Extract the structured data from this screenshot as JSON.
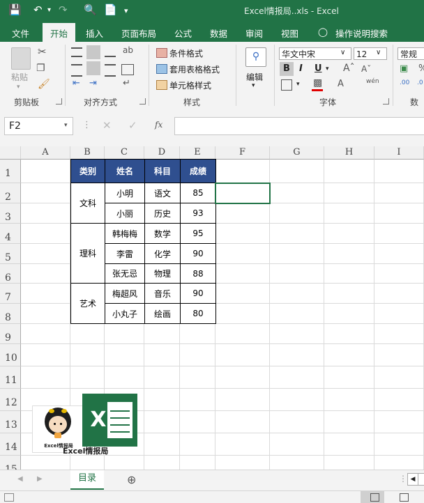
{
  "window": {
    "title": "Excel情报局..xls  -  Excel"
  },
  "ribbon": {
    "tabs": [
      "文件",
      "开始",
      "插入",
      "页面布局",
      "公式",
      "数据",
      "审阅",
      "视图",
      "操作说明搜索"
    ],
    "active_tab": "开始",
    "groups": {
      "clipboard": {
        "label": "剪贴板",
        "paste": "粘贴"
      },
      "alignment": {
        "label": "对齐方式"
      },
      "styles": {
        "label": "样式",
        "conditional": "条件格式",
        "table_format": "套用表格格式",
        "cell_styles": "单元格样式"
      },
      "editing": {
        "label": "编辑"
      },
      "font": {
        "label": "字体",
        "name": "华文中宋",
        "size": "12",
        "bold": "B",
        "italic": "I",
        "underline": "U"
      },
      "number": {
        "label": "数字",
        "format": "常规"
      }
    }
  },
  "formula_bar": {
    "name_box": "F2",
    "fx": "fx",
    "value": ""
  },
  "grid": {
    "columns": [
      "A",
      "B",
      "C",
      "D",
      "E",
      "F",
      "G",
      "H",
      "I"
    ],
    "rows": [
      "1",
      "2",
      "3",
      "4",
      "5",
      "6",
      "7",
      "8",
      "9",
      "10",
      "11",
      "12",
      "13",
      "14",
      "15"
    ]
  },
  "table": {
    "headers": [
      "类别",
      "姓名",
      "科目",
      "成绩"
    ],
    "groups": [
      {
        "category": "文科",
        "rows": [
          [
            "小明",
            "语文",
            "85"
          ],
          [
            "小丽",
            "历史",
            "93"
          ]
        ]
      },
      {
        "category": "理科",
        "rows": [
          [
            "韩梅梅",
            "数学",
            "95"
          ],
          [
            "李雷",
            "化学",
            "90"
          ],
          [
            "张无忌",
            "物理",
            "88"
          ]
        ]
      },
      {
        "category": "艺术",
        "rows": [
          [
            "梅超风",
            "音乐",
            "90"
          ],
          [
            "小丸子",
            "绘画",
            "80"
          ]
        ]
      }
    ]
  },
  "logo": {
    "caption": "Excel情报局",
    "badge": "Excel情报局",
    "letter": "X",
    "accent": "#217346"
  },
  "sheets": {
    "active": "目录"
  },
  "colors": {
    "excel_green": "#217346",
    "header_fill": "#2f4f8f"
  }
}
